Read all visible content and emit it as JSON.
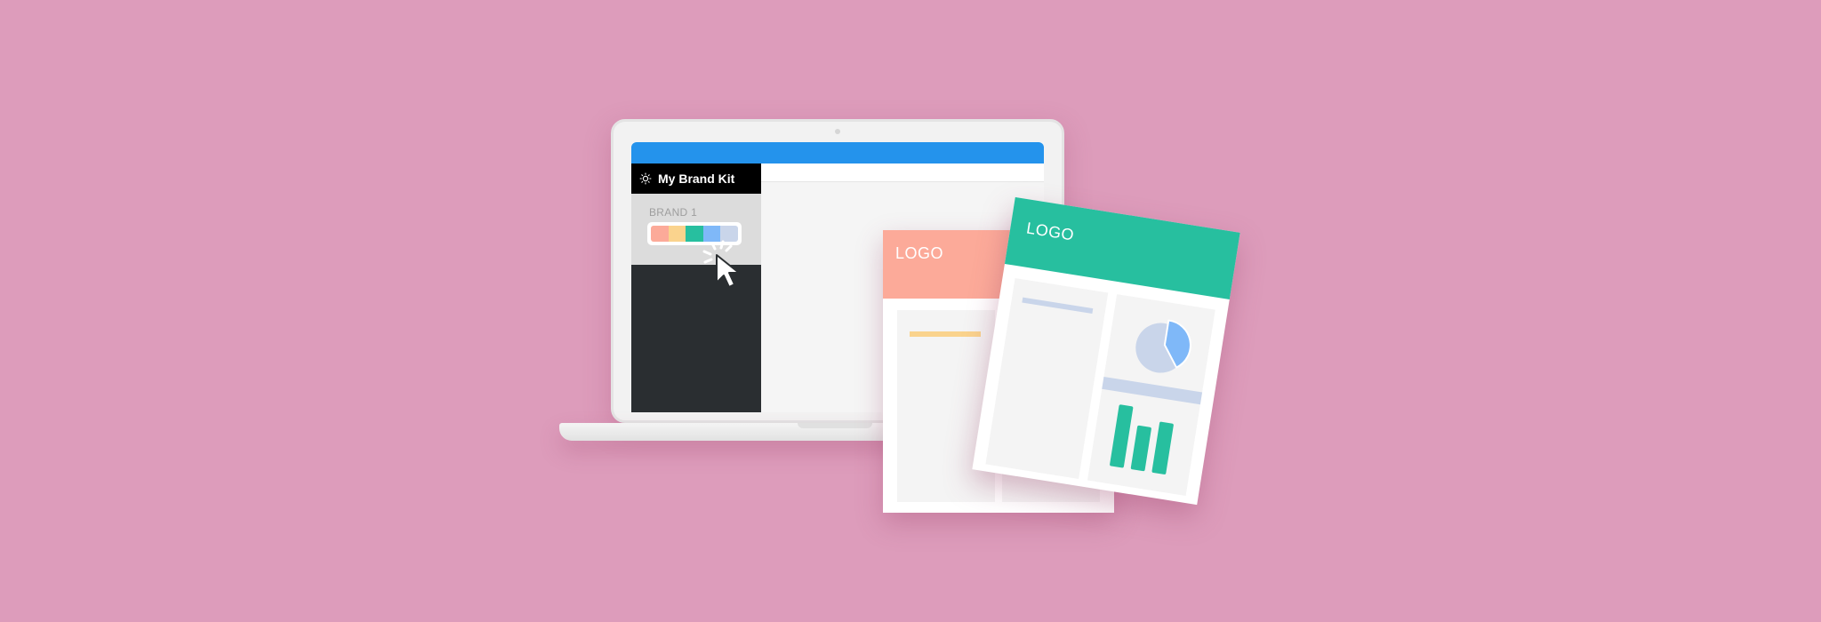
{
  "app": {
    "sidebar": {
      "title": "My Brand Kit",
      "brand_label": "BRAND 1",
      "swatches": [
        "#FCAA99",
        "#FAD38D",
        "#27BF9F",
        "#7FB8F8",
        "#C9D5EA"
      ]
    }
  },
  "cards": {
    "salmon": {
      "logo": "LOGO"
    },
    "teal": {
      "logo": "LOGO"
    }
  },
  "colors": {
    "background": "#DD9CBB",
    "topbar": "#2493EC",
    "sidebar": "#2A2E31",
    "salmon": "#FCAA99",
    "teal": "#27BF9F",
    "yellow": "#FAD38D",
    "light_blue": "#C9D5EA",
    "blue": "#7FB8F8"
  },
  "icons": {
    "gear": "gear-icon",
    "cursor": "cursor-click-icon",
    "pie": "pie-chart-icon",
    "bars": "bar-chart-icon"
  }
}
